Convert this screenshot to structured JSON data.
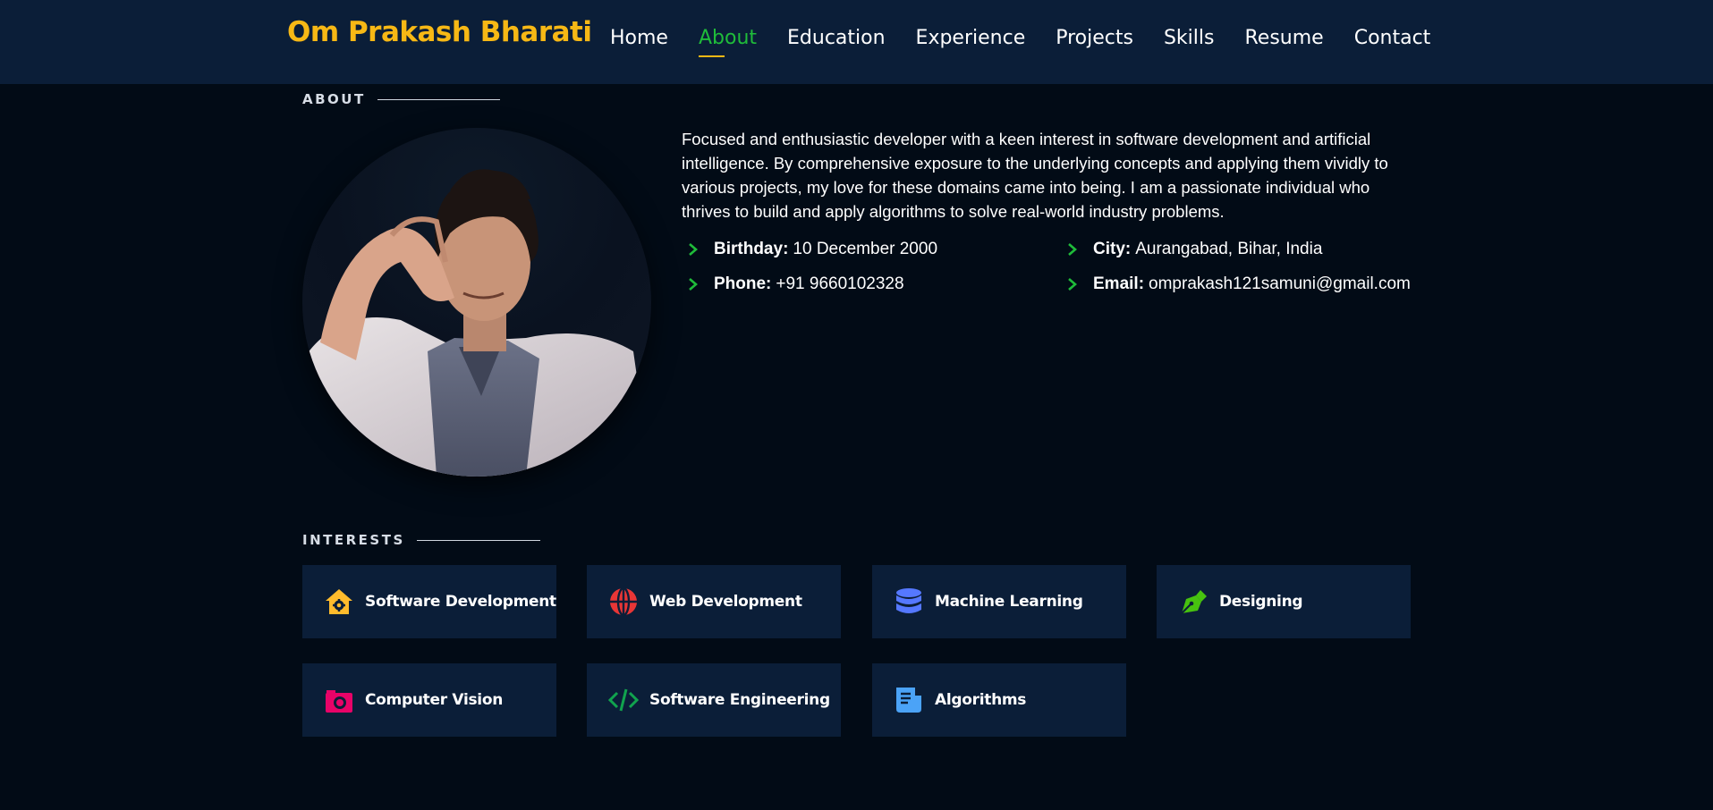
{
  "brand": "Om Prakash Bharati",
  "nav": [
    {
      "label": "Home"
    },
    {
      "label": "About"
    },
    {
      "label": "Education"
    },
    {
      "label": "Experience"
    },
    {
      "label": "Projects"
    },
    {
      "label": "Skills"
    },
    {
      "label": "Resume"
    },
    {
      "label": "Contact"
    }
  ],
  "active_nav": "About",
  "about": {
    "title": "ABOUT",
    "bio": "Focused and enthusiastic developer with a keen interest in software development and artificial intelligence. By comprehensive exposure to the underlying concepts and applying them vividly to various projects, my love for these domains came into being. I am a passionate individual who thrives to build and apply algorithms to solve real-world industry problems.",
    "info": {
      "birthday": {
        "label": "Birthday:",
        "value": "10 December 2000"
      },
      "city": {
        "label": "City:",
        "value": "Aurangabad, Bihar, India"
      },
      "phone": {
        "label": "Phone:",
        "value": "+91 9660102328"
      },
      "email": {
        "label": "Email:",
        "value": "omprakash121samuni@gmail.com"
      }
    }
  },
  "interests": {
    "title": "INTERESTS",
    "items": [
      {
        "label": "Software Development",
        "icon": "house-gear-icon",
        "color": "#ffbb2c"
      },
      {
        "label": "Web Development",
        "icon": "globe-icon",
        "color": "#e83636"
      },
      {
        "label": "Machine Learning",
        "icon": "database-icon",
        "color": "#5578ff"
      },
      {
        "label": "Designing",
        "icon": "pen-nib-icon",
        "color": "#47c20f"
      },
      {
        "label": "Computer Vision",
        "icon": "camera-icon",
        "color": "#e80368"
      },
      {
        "label": "Software Engineering",
        "icon": "code-icon",
        "color": "#11a34e"
      },
      {
        "label": "Algorithms",
        "icon": "document-icon",
        "color": "#4ba3f7"
      }
    ]
  },
  "colors": {
    "background": "#020b16",
    "navbar": "#0b1e38",
    "brand": "#f7b815",
    "accent": "#1fbc3a",
    "card": "#0b1e38"
  }
}
